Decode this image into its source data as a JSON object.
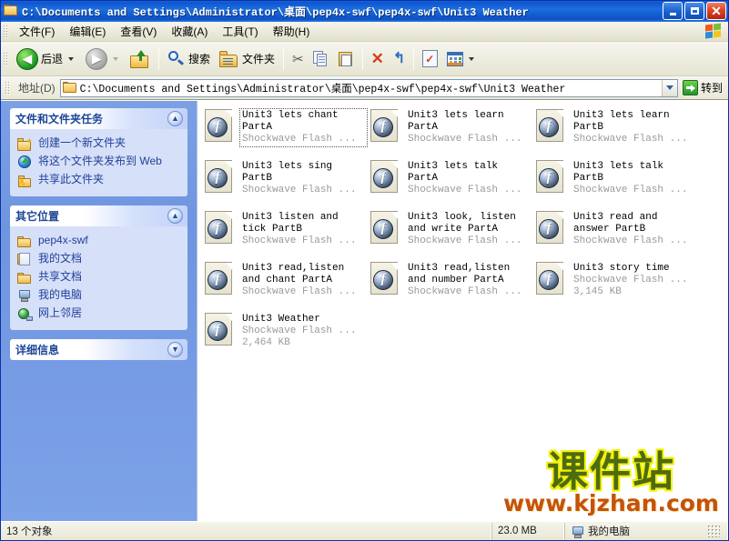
{
  "window": {
    "title": "C:\\Documents and Settings\\Administrator\\桌面\\pep4x-swf\\pep4x-swf\\Unit3 Weather",
    "icon": "folder-icon",
    "minimize_label": "最小化",
    "maximize_label": "最大化",
    "close_label": "关闭"
  },
  "menubar": {
    "items": [
      {
        "label": "文件(F)",
        "name": "menu-file"
      },
      {
        "label": "编辑(E)",
        "name": "menu-edit"
      },
      {
        "label": "查看(V)",
        "name": "menu-view"
      },
      {
        "label": "收藏(A)",
        "name": "menu-favorites"
      },
      {
        "label": "工具(T)",
        "name": "menu-tools"
      },
      {
        "label": "帮助(H)",
        "name": "menu-help"
      }
    ],
    "brand_icon": "windows-flag-icon"
  },
  "toolbar": {
    "back_label": "后退",
    "forward_label": "",
    "search_label": "搜索",
    "folders_label": "文件夹",
    "icons": {
      "back": "back-arrow-icon",
      "forward": "forward-arrow-icon",
      "up": "up-folder-icon",
      "search": "search-magnifier-icon",
      "folders": "folders-icon",
      "cut": "scissors-icon",
      "copy": "copy-icon",
      "paste": "paste-icon",
      "delete": "delete-x-icon",
      "undo": "undo-arrow-icon",
      "properties": "properties-checklist-icon",
      "views": "views-icon"
    }
  },
  "address": {
    "label": "地址(D)",
    "value": "C:\\Documents and Settings\\Administrator\\桌面\\pep4x-swf\\pep4x-swf\\Unit3 Weather",
    "placeholder": "",
    "go_label": "转到",
    "folder_icon": "folder-icon",
    "dropdown_icon": "chevron-down-icon"
  },
  "sidebar": {
    "panels": [
      {
        "title": "文件和文件夹任务",
        "name": "panel-file-tasks",
        "chevron": "chevron-up-icon",
        "collapsed": false,
        "items": [
          {
            "label": "创建一个新文件夹",
            "icon": "new-folder-icon",
            "name": "sidebar-item-new-folder"
          },
          {
            "label": "将这个文件夹发布到 Web",
            "icon": "publish-web-icon",
            "name": "sidebar-item-publish-web"
          },
          {
            "label": "共享此文件夹",
            "icon": "share-folder-icon",
            "name": "sidebar-item-share-folder"
          }
        ]
      },
      {
        "title": "其它位置",
        "name": "panel-other-places",
        "chevron": "chevron-up-icon",
        "collapsed": false,
        "items": [
          {
            "label": "pep4x-swf",
            "icon": "folder-icon",
            "name": "sidebar-item-pep4x-swf"
          },
          {
            "label": "我的文档",
            "icon": "my-documents-icon",
            "name": "sidebar-item-my-documents"
          },
          {
            "label": "共享文档",
            "icon": "folder-icon",
            "name": "sidebar-item-shared-documents"
          },
          {
            "label": "我的电脑",
            "icon": "my-computer-icon",
            "name": "sidebar-item-my-computer"
          },
          {
            "label": "网上邻居",
            "icon": "network-places-icon",
            "name": "sidebar-item-network-places"
          }
        ]
      },
      {
        "title": "详细信息",
        "name": "panel-details",
        "chevron": "chevron-down-icon",
        "collapsed": true,
        "items": []
      }
    ]
  },
  "files": {
    "icon": "shockwave-flash-icon",
    "items": [
      {
        "name": "Unit3 lets chant PartA",
        "type": "Shockwave Flash ...",
        "size": "",
        "focused": true
      },
      {
        "name": "Unit3 lets learn PartA",
        "type": "Shockwave Flash ...",
        "size": "",
        "focused": false
      },
      {
        "name": "Unit3 lets learn PartB",
        "type": "Shockwave Flash ...",
        "size": "",
        "focused": false
      },
      {
        "name": "Unit3 lets sing PartB",
        "type": "Shockwave Flash ...",
        "size": "",
        "focused": false
      },
      {
        "name": "Unit3 lets talk PartA",
        "type": "Shockwave Flash ...",
        "size": "",
        "focused": false
      },
      {
        "name": "Unit3 lets talk PartB",
        "type": "Shockwave Flash ...",
        "size": "",
        "focused": false
      },
      {
        "name": "Unit3 listen and tick PartB",
        "type": "Shockwave Flash ...",
        "size": "",
        "focused": false
      },
      {
        "name": "Unit3 look, listen and write PartA",
        "type": "Shockwave Flash ...",
        "size": "",
        "focused": false
      },
      {
        "name": "Unit3 read and answer PartB",
        "type": "Shockwave Flash ...",
        "size": "",
        "focused": false
      },
      {
        "name": "Unit3 read,listen and chant PartA",
        "type": "Shockwave Flash ...",
        "size": "",
        "focused": false
      },
      {
        "name": "Unit3 read,listen and number PartA",
        "type": "Shockwave Flash ...",
        "size": "",
        "focused": false
      },
      {
        "name": "Unit3 story time",
        "type": "Shockwave Flash ...",
        "size": "3,145 KB",
        "focused": false
      },
      {
        "name": "Unit3 Weather",
        "type": "Shockwave Flash ...",
        "size": "2,464 KB",
        "focused": false
      }
    ]
  },
  "watermark": {
    "chinese": "课件站",
    "url": "www.kjzhan.com"
  },
  "statusbar": {
    "object_count": "13 个对象",
    "total_size": "23.0 MB",
    "location": "我的电脑",
    "location_icon": "my-computer-icon"
  },
  "colors": {
    "titlebar_blue": "#0A50C8",
    "sidebar_blue": "#7BA0E4",
    "panel_body": "#D6E0F8",
    "link_blue": "#22409A",
    "toolbar_beige": "#ECEBDC",
    "watermark_green": "#4F6B10",
    "watermark_yellow": "#F2F20A",
    "watermark_orange": "#C4530A"
  }
}
